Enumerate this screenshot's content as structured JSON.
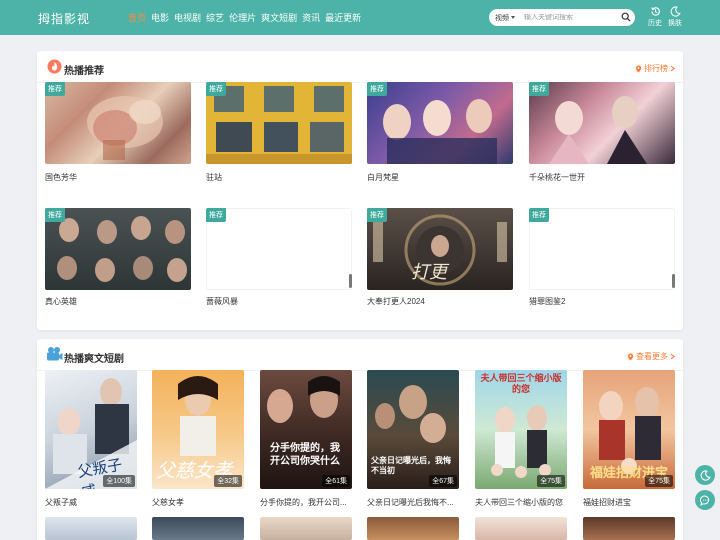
{
  "header": {
    "logo": "拇指影视",
    "nav": [
      {
        "label": "首页",
        "active": true
      },
      {
        "label": "电影",
        "active": false
      },
      {
        "label": "电视剧",
        "active": false
      },
      {
        "label": "综艺",
        "active": false
      },
      {
        "label": "伦理片",
        "active": false
      },
      {
        "label": "爽文短剧",
        "active": false
      },
      {
        "label": "资讯",
        "active": false
      },
      {
        "label": "最近更新",
        "active": false
      }
    ],
    "search": {
      "type_label": "视频",
      "placeholder": "输入关键词搜索"
    },
    "history_label": "历史",
    "skin_label": "换肤"
  },
  "hot": {
    "title": "热播推荐",
    "more_label": "排行榜",
    "badge": "推荐",
    "items": [
      {
        "title": "国色芳华",
        "badge": true
      },
      {
        "title": "驻站",
        "badge": true
      },
      {
        "title": "白月梵星",
        "badge": true
      },
      {
        "title": "千朵桃花一世开",
        "badge": true
      },
      {
        "title": "真心英雄",
        "badge": true
      },
      {
        "title": "蔷薇风暴",
        "badge": true
      },
      {
        "title": "大奉打更人2024",
        "badge": true
      },
      {
        "title": "猎罪图鉴2",
        "badge": true
      }
    ]
  },
  "shorts": {
    "title": "热播爽文短剧",
    "more_label": "查看更多",
    "items": [
      {
        "title": "父叛子威",
        "eps": "全100集",
        "cover_text": "父叛子威"
      },
      {
        "title": "父慈女孝",
        "eps": "全32集",
        "cover_text": "父慈女孝"
      },
      {
        "title": "分手你提的，我开公司...",
        "eps": "全61集",
        "cover_text": "分手你提的，我开公司你哭什么"
      },
      {
        "title": "父亲日记曝光后我悔不...",
        "eps": "全67集",
        "cover_text": "父亲日记曝光后，我悔不当初"
      },
      {
        "title": "夫人带回三个缩小版的您",
        "eps": "全75集",
        "cover_text": "夫人带回三个缩小版的您"
      },
      {
        "title": "福娃招财进宝",
        "eps": "全75集",
        "cover_text": "福娃招财进宝"
      }
    ]
  },
  "colors": {
    "brand": "#4db3a8",
    "accent": "#ff7a33",
    "badge": "#3fa99d"
  }
}
